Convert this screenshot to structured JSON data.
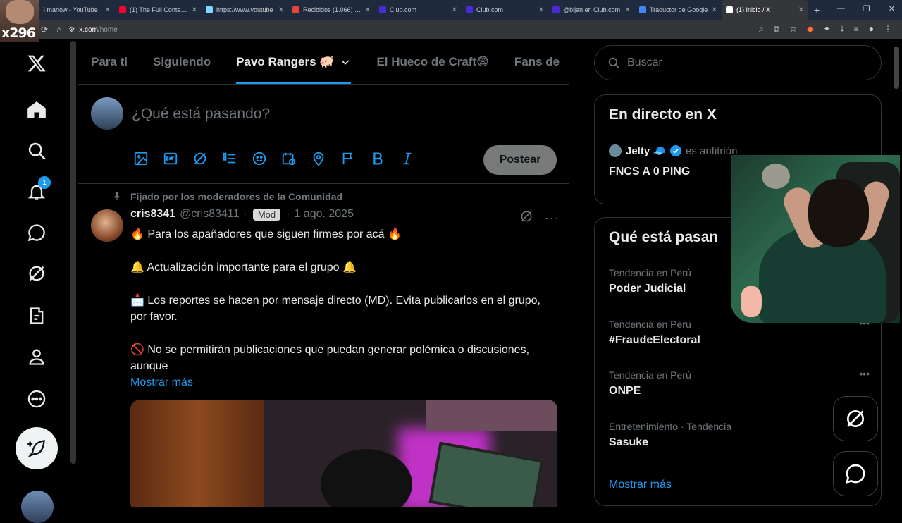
{
  "browser": {
    "tabs": [
      {
        "label": ") marlow - YouTube",
        "color": "#ff0033",
        "active": false
      },
      {
        "label": "(1) The Full Context -",
        "color": "#ff0033",
        "active": false
      },
      {
        "label": "https://www.youtube",
        "color": "#7fd6ff",
        "active": false
      },
      {
        "label": "Recibidos (1.066) - a",
        "color": "#ea4335",
        "active": false
      },
      {
        "label": "Club.com",
        "color": "#4b2bd6",
        "active": false
      },
      {
        "label": "Club.com",
        "color": "#4b2bd6",
        "active": false
      },
      {
        "label": "@bijan en Club.com",
        "color": "#4b2bd6",
        "active": false
      },
      {
        "label": "Traductor de Google",
        "color": "#4285f4",
        "active": false
      },
      {
        "label": "(1) Inicio / X",
        "color": "#ffffff",
        "active": true
      }
    ],
    "url_host": "x.com",
    "url_path": "/home"
  },
  "stream_overlay": {
    "tag": "x296"
  },
  "leftnav": {
    "notification_count": "1"
  },
  "tabs": [
    "Para ti",
    "Siguiendo",
    "Pavo Rangers 🐖",
    "El Hueco de Craft😨",
    "Fans de"
  ],
  "composer": {
    "placeholder": "¿Qué está pasando?",
    "post_label": "Postear"
  },
  "post": {
    "pinned_label": "Fijado por los moderadores de la Comunidad",
    "name": "cris8341",
    "handle": "@cris83411",
    "mod_badge": "Mod",
    "dot": "·",
    "date": "1 ago. 2025",
    "line1": "🔥 Para los apañadores que siguen firmes por acá 🔥",
    "line2": "🔔 Actualización importante para el grupo 🔔",
    "line3": "📩 Los reportes se hacen por mensaje directo (MD). Evita publicarlos en el grupo, por favor.",
    "line4": "🚫 No se permitirán publicaciones que puedan generar polémica o discusiones, aunque",
    "show_more": "Mostrar más"
  },
  "right": {
    "search_placeholder": "Buscar",
    "live_title": "En directo en X",
    "live_host": "Jelty 🧢",
    "live_host_suffix": "es anfitrión",
    "live_stream_title": "FNCS A 0 PING",
    "trends_title": "Qué está pasan",
    "trends": [
      {
        "context": "Tendencia en Perú",
        "name": "Poder Judicial"
      },
      {
        "context": "Tendencia en Perú",
        "name": "#FraudeElectoral"
      },
      {
        "context": "Tendencia en Perú",
        "name": "ONPE"
      },
      {
        "context": "Entretenimiento · Tendencia",
        "name": "Sasuke"
      }
    ],
    "show_more": "Mostrar más"
  }
}
